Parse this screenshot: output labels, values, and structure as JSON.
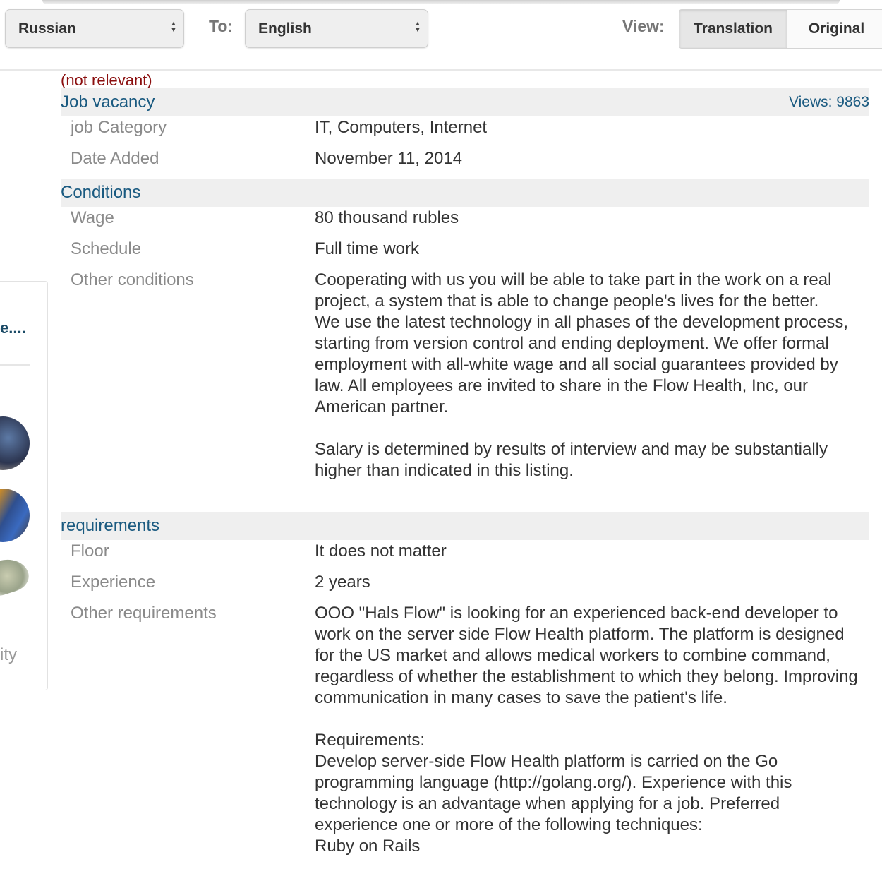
{
  "toolbar": {
    "from_language": "Russian",
    "to_label": "To:",
    "to_language": "English",
    "view_label": "View:",
    "view_options": [
      {
        "label": "Translation",
        "active": true
      },
      {
        "label": "Original",
        "active": false
      }
    ]
  },
  "sidebar": {
    "title_fragment": "e....",
    "bottom_fragment": "ity",
    "thumbnails": [
      "car-thumbnail",
      "people-thumbnail",
      "money-thumbnail"
    ]
  },
  "listing": {
    "status": "(not relevant)",
    "views": "Views: 9863",
    "sections": [
      {
        "title": "Job vacancy",
        "rows": [
          {
            "label": "job Category",
            "value": "IT, Computers, Internet"
          },
          {
            "label": "Date Added",
            "value": "November 11, 2014"
          }
        ]
      },
      {
        "title": "Conditions",
        "rows": [
          {
            "label": "Wage",
            "value": "80 thousand rubles"
          },
          {
            "label": "Schedule",
            "value": "Full time work"
          },
          {
            "label": "Other conditions",
            "value": "Cooperating with us you will be able to take part in the work on a real project, a system that is able to change people's lives for the better.\nWe use the latest technology in all phases of the development process, starting from version control and ending deployment. We offer formal employment with all-white wage and all social guarantees provided by law. All employees are invited to share in the Flow Health, Inc, our American partner.\n\nSalary is determined by results of interview and may be substantially higher than indicated in this listing."
          }
        ]
      },
      {
        "title": "requirements",
        "rows": [
          {
            "label": "Floor",
            "value": "It does not matter"
          },
          {
            "label": "Experience",
            "value": "2 years"
          },
          {
            "label": "Other requirements",
            "value": "OOO \"Hals Flow\" is looking for an experienced back-end developer to work on the server side Flow Health platform. The platform is designed for the US market and allows medical workers to combine command, regardless of whether the establishment to which they belong. Improving communication in many cases to save the patient's life.\n\nRequirements:\nDevelop server-side Flow Health platform is carried on the Go programming language (http://golang.org/). Experience with this technology is an advantage when applying for a job. Preferred experience one or more of the following techniques:\nRuby on Rails"
          }
        ]
      }
    ]
  }
}
